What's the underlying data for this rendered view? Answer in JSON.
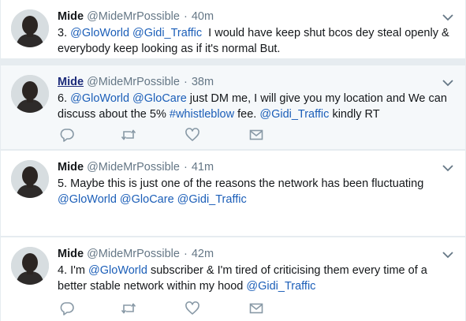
{
  "colors": {
    "link": "#1b5eb8",
    "meta": "#657786",
    "highlight_bg": "#f5f8fa",
    "background": "#e6ecf0"
  },
  "icons": {
    "reply": "reply-icon",
    "retweet": "retweet-icon",
    "like": "heart-icon",
    "dm": "envelope-icon",
    "caret": "chevron-down-icon"
  },
  "tweets": [
    {
      "name": "Mide",
      "handle": "@MideMrPossible",
      "sep": "·",
      "time": "40m",
      "num": "3.",
      "mention1": "@GloWorld",
      "mention2": "@Gidi_Traffic",
      "body": "I would have keep shut bcos dey steal openly & everybody keep looking as if it's normal But."
    },
    {
      "name": "Mide",
      "handle": "@MideMrPossible",
      "sep": "·",
      "time": "38m",
      "num": "6.",
      "mention1": "@GloWorld",
      "mention2": "@GloCare",
      "body1": "just DM me, I will give you my location and We can discuss about the 5%",
      "hashtag": "#whistleblow",
      "body2": "fee.",
      "mention3": "@Gidi_Traffic",
      "body3": "kindly RT"
    },
    {
      "name": "Mide",
      "handle": "@MideMrPossible",
      "sep": "·",
      "time": "41m",
      "body": "5. Maybe this is just one of the reasons the network has been fluctuating",
      "mention1": "@GloWorld",
      "mention2": "@GloCare",
      "mention3": "@Gidi_Traffic"
    },
    {
      "name": "Mide",
      "handle": "@MideMrPossible",
      "sep": "·",
      "time": "42m",
      "num": "4. I'm",
      "mention1": "@GloWorld",
      "body": "subscriber & I'm tired of criticising them every time of a better stable network within my hood",
      "mention2": "@Gidi_Traffic"
    }
  ]
}
